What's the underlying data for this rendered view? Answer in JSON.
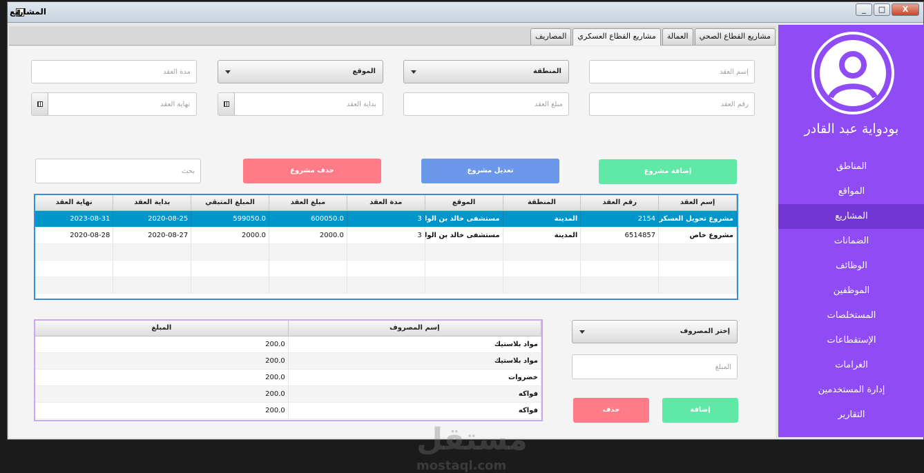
{
  "window": {
    "title": "المشاريع",
    "controls": [
      "_",
      "□",
      "X"
    ]
  },
  "sidebar": {
    "user_name": "بودواية عبد القادر",
    "items": [
      {
        "label": "المناطق",
        "active": false
      },
      {
        "label": "المواقع",
        "active": false
      },
      {
        "label": "المشاريع",
        "active": true
      },
      {
        "label": "الضمانات",
        "active": false
      },
      {
        "label": "الوظائف",
        "active": false
      },
      {
        "label": "الموظفين",
        "active": false
      },
      {
        "label": "المستخلصات",
        "active": false
      },
      {
        "label": "الإستقطاعات",
        "active": false
      },
      {
        "label": "الغرامات",
        "active": false
      },
      {
        "label": "إدارة المستخدمين",
        "active": false
      },
      {
        "label": "التقارير",
        "active": false
      }
    ]
  },
  "tabs": [
    {
      "label": "مشاريع القطاع الصحي",
      "active": false
    },
    {
      "label": "العمالة",
      "active": false
    },
    {
      "label": "مشاريع القطاع العسكري",
      "active": true
    },
    {
      "label": "المصاريف",
      "active": false
    }
  ],
  "form": {
    "contract_name_placeholder": "إسم العقد",
    "region_combo": "المنطقة",
    "site_combo": "الموقع",
    "duration_placeholder": "مدة العقد",
    "contract_number_placeholder": "رقم العقد",
    "amount_placeholder": "مبلغ العقد",
    "start_placeholder": "بداية العقد",
    "end_placeholder": "نهاية العقد"
  },
  "actions": {
    "add": "إضافة مشروع",
    "edit": "تعديل مشروع",
    "delete": "حذف مشروع",
    "search_placeholder": "بحث"
  },
  "projects_table": {
    "columns": [
      "إسم العقد",
      "رقم العقد",
      "المنطقة",
      "الموقع",
      "مدة العقد",
      "مبلغ العقد",
      "المبلغ المتبقي",
      "بداية العقد",
      "نهاية العقد"
    ],
    "rows": [
      [
        "مشروع تحويل العسكرية",
        "2154",
        "المدينة",
        "مستشفى خالد بن الوليد",
        "3",
        "600050.0",
        "599050.0",
        "2020-08-25",
        "2023-08-31"
      ],
      [
        "مشروع خاص",
        "6514857",
        "المدينة",
        "مستشفى خالد بن الوليد",
        "3",
        "2000.0",
        "2000.0",
        "2020-08-27",
        "2020-08-28"
      ]
    ],
    "selected_row": 0
  },
  "expense_form": {
    "combo": "إختر المصروف",
    "amount_placeholder": "المبلغ",
    "add": "إضافة",
    "delete": "حذف"
  },
  "expenses_table": {
    "columns": [
      "إسم المصروف",
      "المبلغ"
    ],
    "rows": [
      [
        "مواد بلاستيك",
        "200.0"
      ],
      [
        "مواد بلاستيك",
        "200.0"
      ],
      [
        "خضروات",
        "200.0"
      ],
      [
        "فواكه",
        "200.0"
      ],
      [
        "فواكه",
        "200.0"
      ]
    ]
  },
  "watermark": {
    "ar": "مستقل",
    "en": "mostaql.com"
  },
  "colors": {
    "sidebar": "#8f4cf5",
    "sidebar_active": "#7136d3",
    "add": "#5fe8a6",
    "edit": "#6b98e8",
    "delete": "#ff7b87",
    "selection": "#0096c9"
  }
}
